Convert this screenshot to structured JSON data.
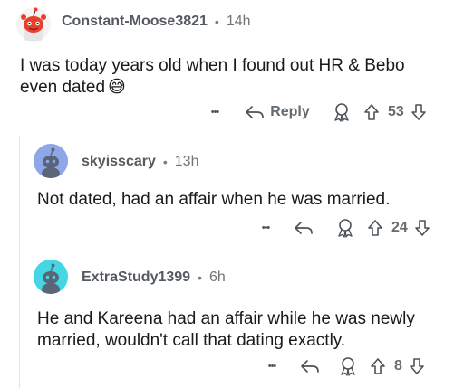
{
  "comments": [
    {
      "username": "Constant-Moose3821",
      "separator": "•",
      "time": "14h",
      "text_line1": "I was today years old when I found out HR & Bebo",
      "text_line2": "even dated",
      "emoji": "😅",
      "more": "•••",
      "reply_label": "Reply",
      "votes": "53"
    },
    {
      "username": "skyisscary",
      "separator": "•",
      "time": "13h",
      "text": "Not dated, had an affair when he was married.",
      "more": "•••",
      "votes": "24"
    },
    {
      "username": "ExtraStudy1399",
      "separator": "•",
      "time": "6h",
      "text_line1": "He and Kareena had an affair while he was newly",
      "text_line2": "married, wouldn't call that dating exactly.",
      "more": "•••",
      "votes": "8"
    }
  ]
}
